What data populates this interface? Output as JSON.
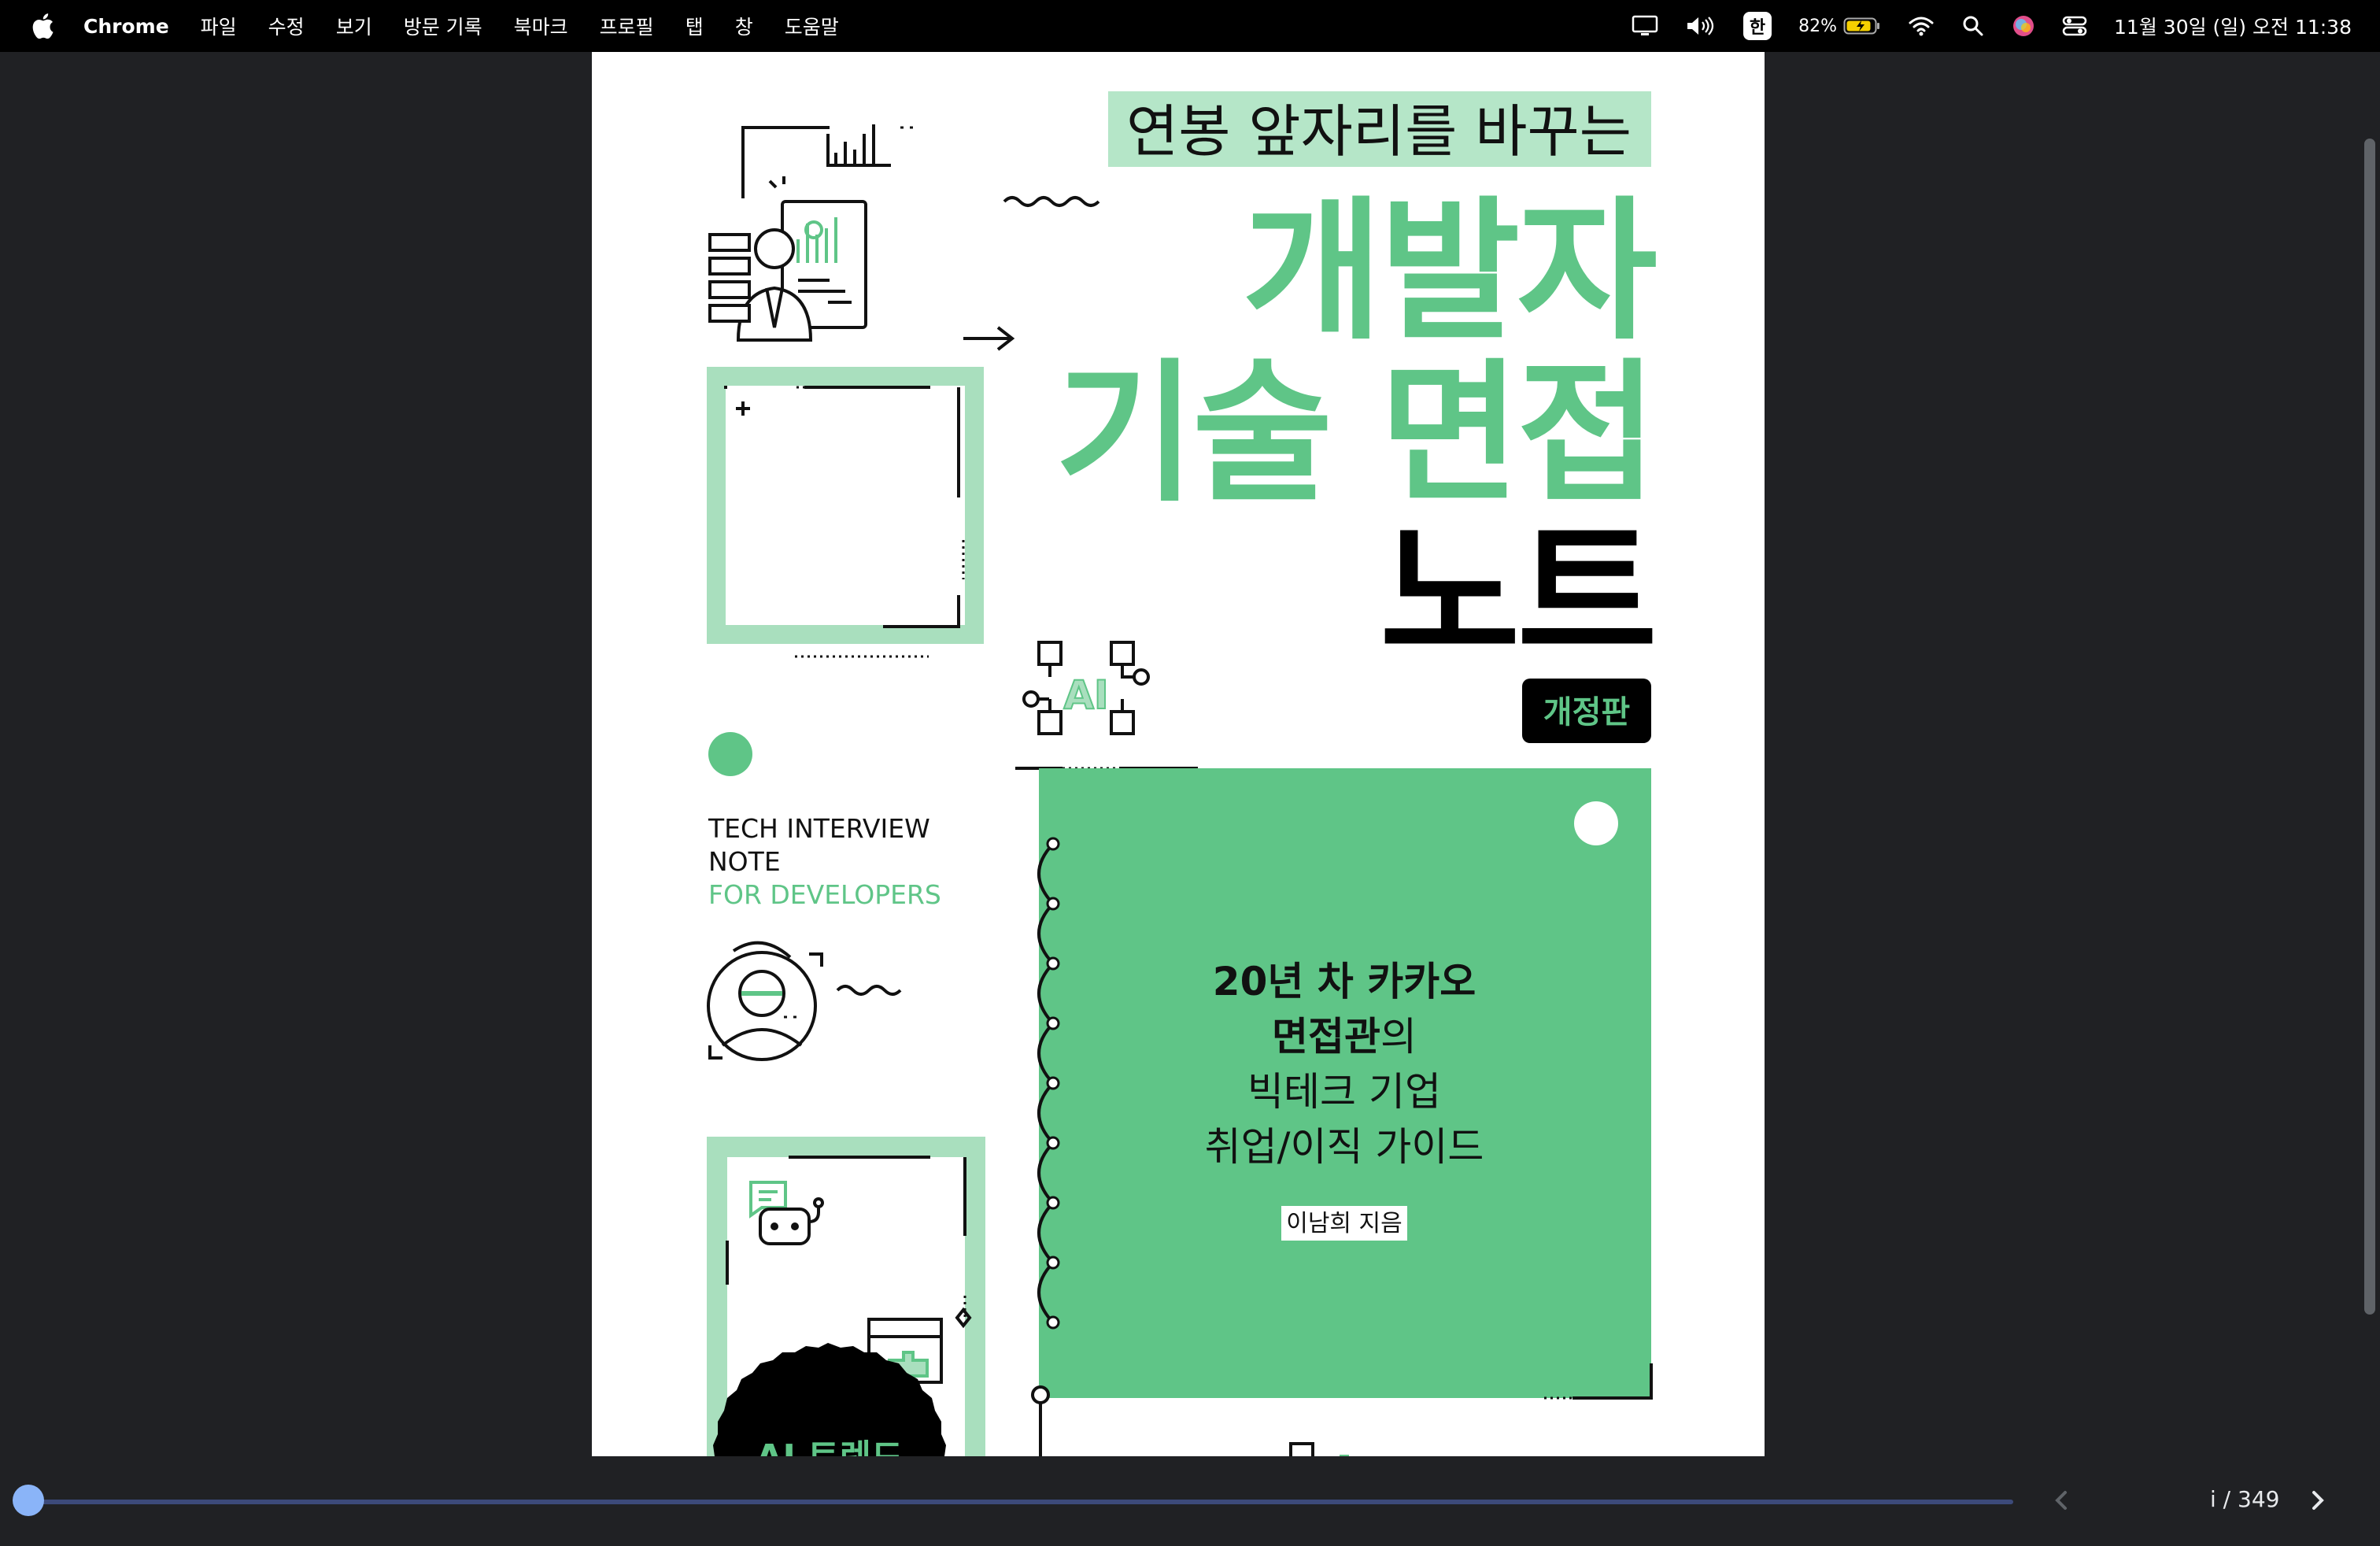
{
  "menubar": {
    "app_name": "Chrome",
    "menus": [
      "파일",
      "수정",
      "보기",
      "방문 기록",
      "북마크",
      "프로필",
      "탭",
      "창",
      "도움말"
    ],
    "ime": "한",
    "battery": "82%",
    "clock": "11월 30일 (일) 오전 11:38"
  },
  "book": {
    "subtitle": "연봉 앞자리를 바꾸는",
    "title_line1": "개발자",
    "title_line2": "기술 면접",
    "title_line3": "노트",
    "edition_badge": "개정판",
    "ai_label": "AI",
    "english_line1": "TECH INTERVIEW",
    "english_line2": "NOTE",
    "english_line3": "FOR DEVELOPERS",
    "card_line1": "20년 차 카카오",
    "card_line2a": "면접관",
    "card_line2b": "의",
    "card_line3": "빅테크 기업",
    "card_line4": "취업/이직 가이드",
    "author": "이남희 지음",
    "badge_partial": "AI 트렌드"
  },
  "colors": {
    "accent": "#5fc587",
    "accent_light": "#a9dfbe",
    "subtitle_bg": "#b5e6c8"
  },
  "pager": {
    "label": "i / 349"
  }
}
